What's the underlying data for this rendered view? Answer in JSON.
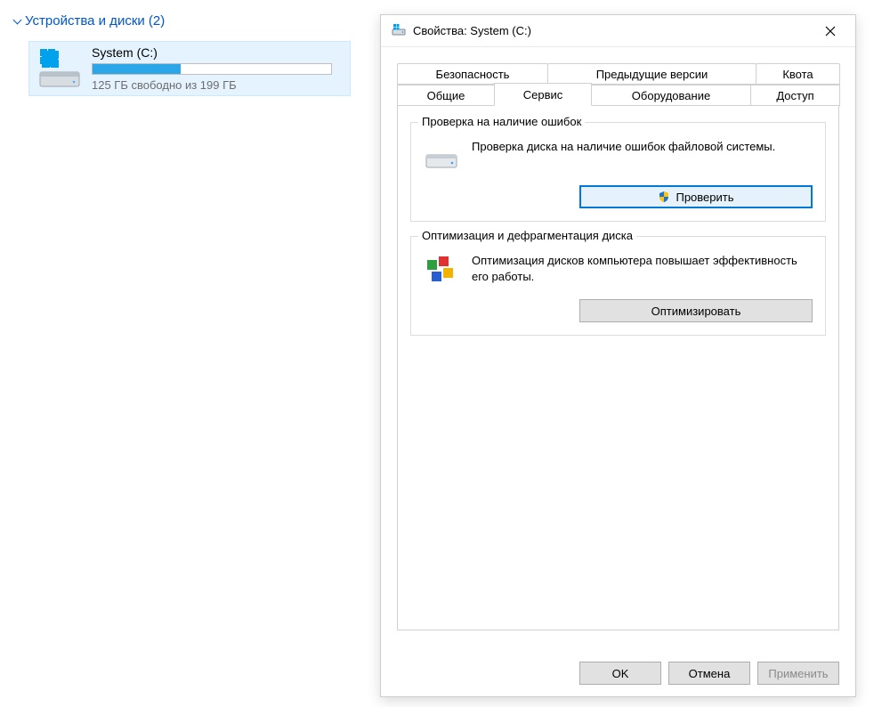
{
  "explorer": {
    "group_header": "Устройства и диски (2)",
    "drive": {
      "name": "System (C:)",
      "subtext": "125 ГБ свободно из 199 ГБ",
      "used_percent": 37
    }
  },
  "dialog": {
    "title": "Свойства: System (C:)",
    "tabs_row1": [
      {
        "label": "Безопасность"
      },
      {
        "label": "Предыдущие версии"
      },
      {
        "label": "Квота"
      }
    ],
    "tabs_row2": [
      {
        "label": "Общие"
      },
      {
        "label": "Сервис",
        "active": true
      },
      {
        "label": "Оборудование"
      },
      {
        "label": "Доступ"
      }
    ],
    "group_check": {
      "legend": "Проверка на наличие ошибок",
      "text": "Проверка диска на наличие ошибок файловой системы.",
      "button": "Проверить"
    },
    "group_optimize": {
      "legend": "Оптимизация и дефрагментация диска",
      "text": "Оптимизация дисков компьютера повышает эффективность его работы.",
      "button": "Оптимизировать"
    },
    "footer": {
      "ok": "OK",
      "cancel": "Отмена",
      "apply": "Применить"
    }
  }
}
